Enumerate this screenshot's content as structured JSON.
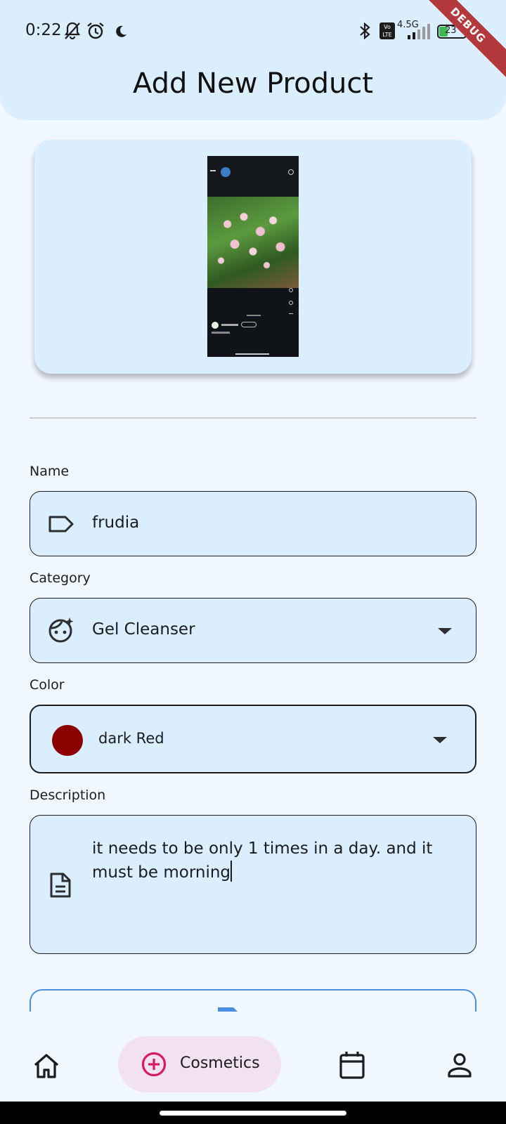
{
  "status_bar": {
    "time": "0:22",
    "network": "4.5G",
    "volte": "Vo LTE",
    "battery": "23",
    "debug_label": "DEBUG"
  },
  "page": {
    "title": "Add New Product"
  },
  "form": {
    "name": {
      "label": "Name",
      "value": "frudia",
      "icon": "label-tag-icon"
    },
    "category": {
      "label": "Category",
      "value": "Gel Cleanser",
      "icon": "face-sparkle-icon"
    },
    "color": {
      "label": "Color",
      "value": "dark Red",
      "swatch": "#8b0000"
    },
    "description": {
      "label": "Description",
      "value": "it needs to be only 1 times in a day. and it must be morning",
      "icon": "document-icon"
    }
  },
  "bottom_nav": {
    "items": [
      {
        "icon": "home-icon"
      },
      {
        "icon": "add-circle-icon",
        "label": "Cosmetics",
        "active": true
      },
      {
        "icon": "calendar-icon"
      },
      {
        "icon": "person-icon"
      }
    ]
  },
  "colors": {
    "header_bg": "#dbeefd",
    "page_bg": "#f1f7fe",
    "field_bg": "#dbeefd",
    "active_pill": "#f2e1ee",
    "accent_pink": "#d81b60",
    "accent_blue": "#4a8fe0"
  }
}
